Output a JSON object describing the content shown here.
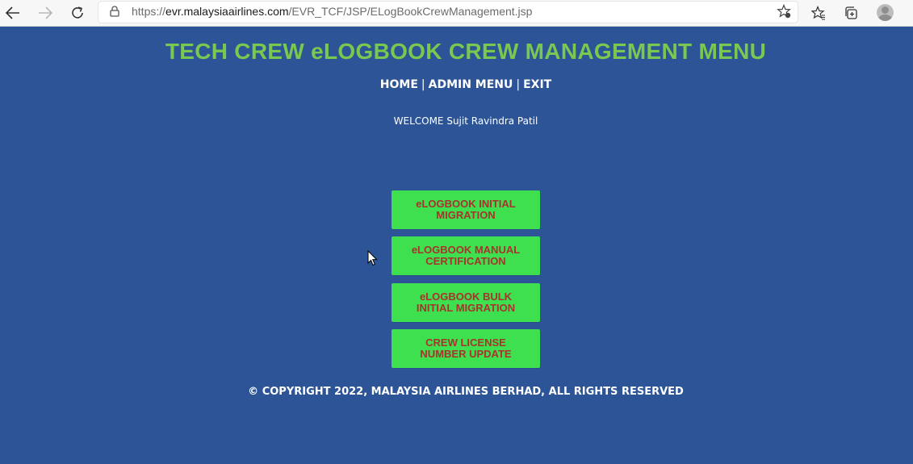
{
  "browser": {
    "url_prefix": "https://",
    "url_host": "evr.malaysiaairlines.com",
    "url_path": "/EVR_TCF/JSP/ELogBookCrewManagement.jsp",
    "icons": {
      "back": "back-arrow-icon",
      "forward": "forward-arrow-icon",
      "reload": "reload-icon",
      "lock": "lock-icon",
      "favorite": "add-favorite-icon",
      "favorites": "favorites-icon",
      "collections": "collections-icon",
      "profile": "profile-avatar-icon"
    }
  },
  "page": {
    "title": "TECH CREW eLOGBOOK CREW MANAGEMENT MENU",
    "nav": {
      "home": "HOME",
      "admin_menu": "ADMIN MENU",
      "exit": "EXIT",
      "separator": "|"
    },
    "welcome": "WELCOME Sujit Ravindra Patil",
    "menu": [
      {
        "label": "eLOGBOOK INITIAL MIGRATION"
      },
      {
        "label": "eLOGBOOK MANUAL CERTIFICATION"
      },
      {
        "label": "eLOGBOOK BULK INITIAL MIGRATION"
      },
      {
        "label": "CREW LICENSE NUMBER UPDATE"
      }
    ],
    "copyright": "© COPYRIGHT 2022, MALAYSIA AIRLINES BERHAD, ALL RIGHTS RESERVED"
  },
  "colors": {
    "background": "#2c5496",
    "title": "#79c84f",
    "button_bg": "#3fe04f",
    "button_text": "#a8322d",
    "text": "#ffffff"
  }
}
